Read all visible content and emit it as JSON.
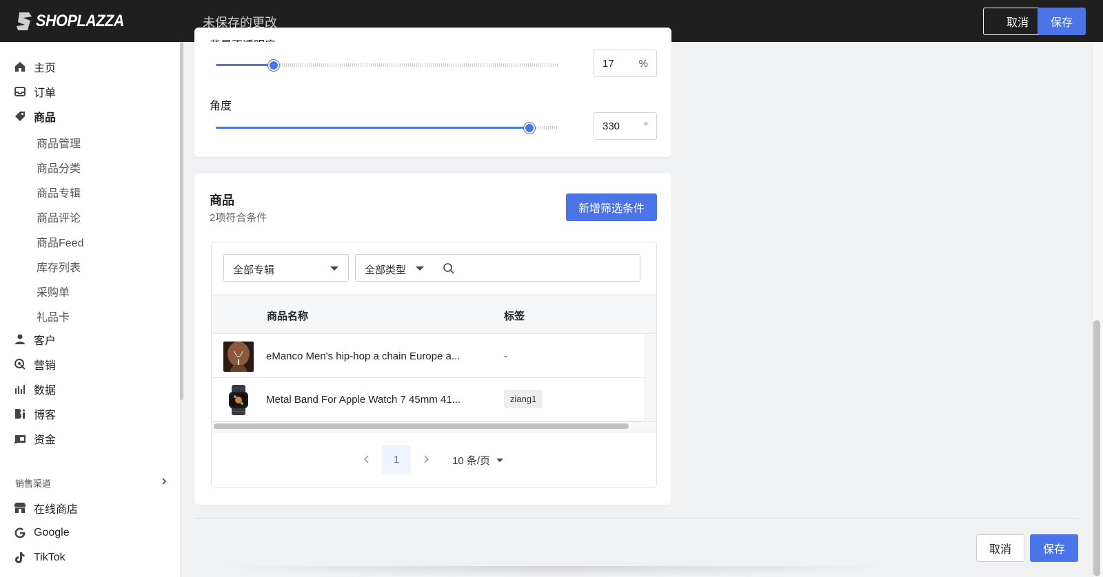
{
  "topbar": {
    "logo_text": "SHOPLAZZA",
    "title": "未保存的更改",
    "cancel_label": "取消",
    "save_label": "保存"
  },
  "sidebar": {
    "items": [
      {
        "label": "主页",
        "icon": "home-icon"
      },
      {
        "label": "订单",
        "icon": "inbox-icon"
      },
      {
        "label": "商品",
        "icon": "tag-icon"
      },
      {
        "label": "客户",
        "icon": "person-icon"
      },
      {
        "label": "营销",
        "icon": "target-icon"
      },
      {
        "label": "数据",
        "icon": "bar-chart-icon"
      },
      {
        "label": "博客",
        "icon": "blog-icon"
      },
      {
        "label": "资金",
        "icon": "wallet-icon"
      }
    ],
    "sub_items": [
      "商品管理",
      "商品分类",
      "商品专辑",
      "商品评论",
      "商品Feed",
      "库存列表",
      "采购单",
      "礼品卡"
    ],
    "section_label": "销售渠道",
    "channels": [
      {
        "label": "在线商店",
        "icon": "store-icon"
      },
      {
        "label": "Google",
        "icon": "google-icon"
      },
      {
        "label": "TikTok",
        "icon": "tiktok-icon"
      }
    ]
  },
  "style_card": {
    "partial_label": "背景不透明度",
    "opacity": {
      "value": "17",
      "unit": "%",
      "fraction": 0.17
    },
    "angle_label": "角度",
    "angle": {
      "value": "330",
      "unit": "°",
      "fraction": 0.917
    }
  },
  "products_card": {
    "title": "商品",
    "subtitle": "2项符合条件",
    "add_button": "新增筛选条件",
    "filter_collection": "全部专辑",
    "filter_type": "全部类型",
    "search_placeholder": "",
    "columns": [
      "商品名称",
      "标签"
    ],
    "rows": [
      {
        "name": "eManco Men's hip-hop a chain Europe a...",
        "tag": "-"
      },
      {
        "name": "Metal Band For Apple Watch 7 45mm 41...",
        "tag": "ziang1"
      }
    ],
    "pagination": {
      "current": "1",
      "page_size": "10 条/页"
    }
  },
  "footer": {
    "cancel_label": "取消",
    "save_label": "保存"
  },
  "colors": {
    "accent": "#4a74e8",
    "topbar": "#1f1f1f"
  }
}
